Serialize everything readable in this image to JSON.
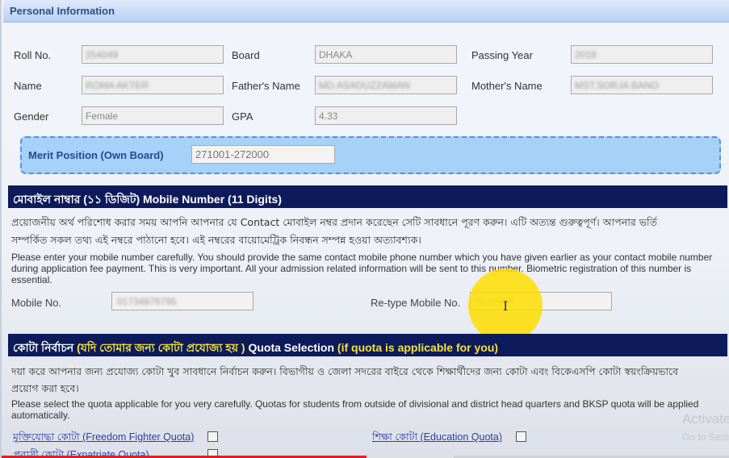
{
  "personal_info": {
    "title": "Personal Information",
    "fields": {
      "roll_no": {
        "label": "Roll No.",
        "value": "254049"
      },
      "board": {
        "label": "Board",
        "value": "DHAKA"
      },
      "passing_year": {
        "label": "Passing Year",
        "value": "2018"
      },
      "name": {
        "label": "Name",
        "value": "ROMA AKTER"
      },
      "fathers_name": {
        "label": "Father's Name",
        "value": "MD.ASADUZZAMAN"
      },
      "mothers_name": {
        "label": "Mother's Name",
        "value": "MST.SORJA BANO"
      },
      "gender": {
        "label": "Gender",
        "value": "Female"
      },
      "gpa": {
        "label": "GPA",
        "value": "4.33"
      }
    },
    "merit": {
      "label": "Merit Position (Own Board)",
      "value": "271001-272000"
    }
  },
  "mobile_section": {
    "title": "মোবাইল নাম্বার (১১ ডিজিট) Mobile Number (11 Digits)",
    "bn_line1": "প্রয়োজনীয় অর্থ পরিশোধ করার সময় আপনি আপনার যে Contact মোবাইল নম্বর প্রদান করেছেন সেটি সাবধানে পূরণ করুন। এটি অত্যন্ত গুরুত্বপূর্ণ। আপনার ভর্তি",
    "bn_line2": "সম্পর্কিত সকল তথ্য এই নম্বরে পাঠানো হবে। এই নম্বরের বায়োমেট্রিক নিবন্ধন সম্পন্ন হওয়া অত্যাবশ্যক।",
    "en_text": "Please enter your mobile number carefully. You should provide the same contact mobile phone number which you have given earlier as your contact mobile number during application fee payment. This is very important. All your admission related information will be sent to this number. Biometric registration of this number is essential.",
    "mobile_label": "Mobile No.",
    "mobile_value": "01734876795",
    "retype_label": "Re-type Mobile No.",
    "retype_value": "0173487"
  },
  "quota_section": {
    "title_bn": "কোটা নির্বাচন",
    "title_bn_yellow": "(যদি তোমার জন্য কোটা প্রযোজ্য হয় )",
    "title_en": "Quota Selection",
    "title_en_yellow": "(if quota is applicable for you)",
    "bn_line1": "দয়া করে আপনার জন্য প্রযোজ্য কোটা খুব সাবধানে নির্বাচন করুন। বিভাগীয় ও জেলা সদরের বাইরে থেকে শিক্ষার্থীদের জন্য কোটা এবং বিকেএসপি কোটা স্বয়ংক্রিয়ভাবে",
    "bn_line2": "প্রয়োগ করা হবে।",
    "en_text": "Please select the quota applicable for you very carefully. Quotas for students from outside of divisional and district head quarters and BKSP quota will be applied automatically.",
    "quotas": [
      {
        "label": "মুক্তিযোদ্ধা কোটা (Freedom Fighter Quota)",
        "checked": false
      },
      {
        "label": "শিক্ষা কোটা (Education Quota)",
        "checked": false
      },
      {
        "label": "প্রবাসী কোটা (Expatriate Quota)",
        "checked": false
      }
    ]
  },
  "watermark": {
    "line1": "Activate Windows",
    "line2": "Go to Settings to activate Windows."
  },
  "video_progress": {
    "played_fraction": 0.5,
    "buffered_fraction": 0.62
  },
  "colors": {
    "section_bar": "#0d1b5a",
    "highlight_yellow": "#f3e13d",
    "merit_box": "#a6d2fa",
    "link": "#2b3fa8"
  }
}
